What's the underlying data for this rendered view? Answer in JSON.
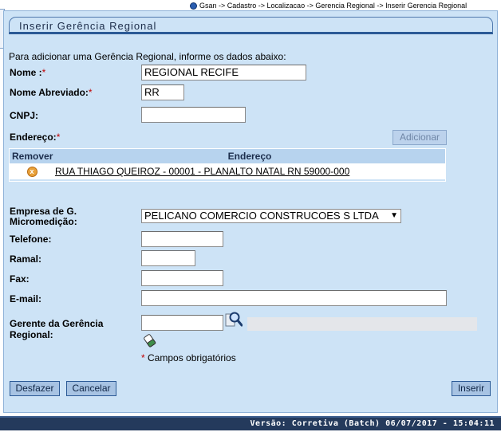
{
  "breadcrumb": {
    "text": "Gsan -> Cadastro -> Localizacao -> Gerencia Regional -> Inserir Gerencia Regional"
  },
  "panel": {
    "title": "Inserir Gerência Regional",
    "intro": "Para adicionar uma Gerência Regional, informe os dados abaixo:"
  },
  "form": {
    "nome_label": "Nome :",
    "nome_value": "REGIONAL RECIFE",
    "nome_abrev_label": "Nome Abreviado:",
    "nome_abrev_value": "RR",
    "cnpj_label": "CNPJ:",
    "cnpj_value": "",
    "endereco_label": "Endereço:",
    "adicionar_label": "Adicionar",
    "empresa_label_1": "Empresa de G.",
    "empresa_label_2": "Micromedição:",
    "empresa_value": "PELICANO COMERCIO CONSTRUCOES S LTDA",
    "telefone_label": "Telefone:",
    "telefone_value": "",
    "ramal_label": "Ramal:",
    "ramal_value": "",
    "fax_label": "Fax:",
    "fax_value": "",
    "email_label": "E-mail:",
    "email_value": "",
    "gerente_label_1": "Gerente da Gerência",
    "gerente_label_2": "Regional:",
    "gerente_value": "",
    "required_mark": "*",
    "footnote": "Campos obrigatórios"
  },
  "address_table": {
    "headers": [
      "Remover",
      "Endereço"
    ],
    "rows": [
      {
        "address": "RUA THIAGO QUEIROZ - 00001 - PLANALTO NATAL RN 59000-000"
      }
    ]
  },
  "buttons": {
    "desfazer": "Desfazer",
    "cancelar": "Cancelar",
    "inserir": "Inserir"
  },
  "footer": {
    "version": "Versão: Corretiva (Batch) 06/07/2017 - 15:04:11"
  },
  "colors": {
    "panel_bg": "#cde3f6",
    "accent": "#2b5a96",
    "required": "#c00000",
    "footer_bg": "#243a5c"
  },
  "icons": {
    "breadcrumb": "gsan-globe-icon",
    "remove": "remove-x-icon",
    "search": "magnifier-search-icon",
    "clear": "eraser-icon"
  }
}
